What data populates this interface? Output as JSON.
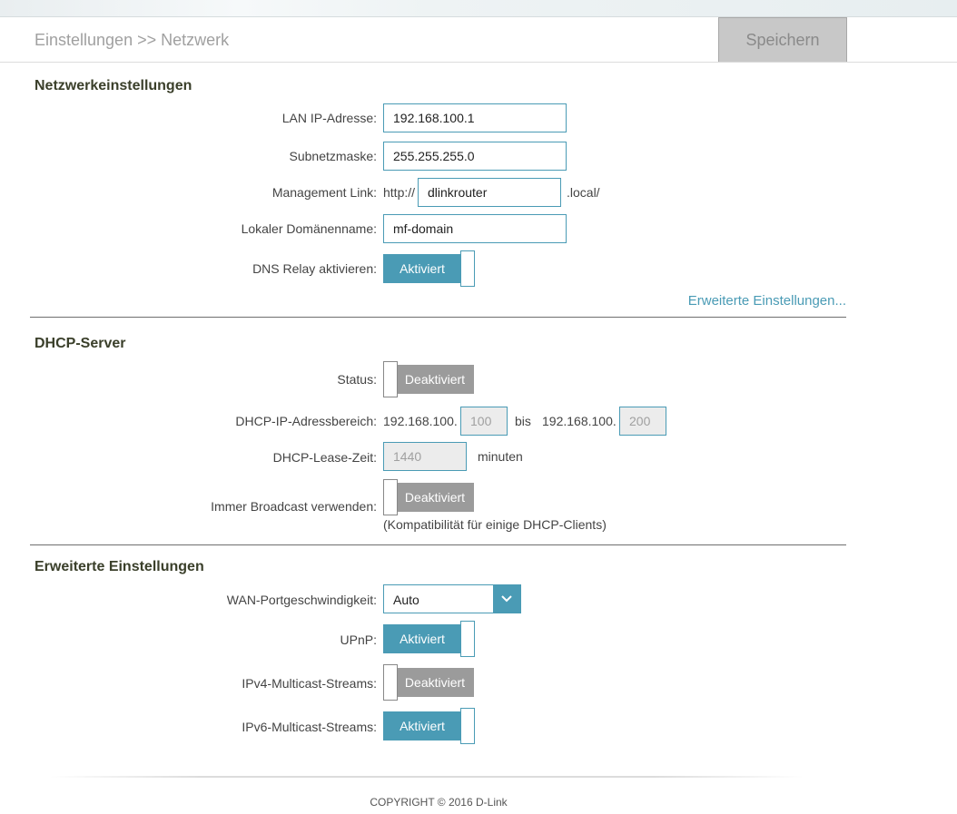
{
  "header": {
    "breadcrumb": "Einstellungen >> Netzwerk",
    "save_label": "Speichern"
  },
  "network": {
    "title": "Netzwerkeinstellungen",
    "lan_ip_label": "LAN IP-Adresse:",
    "lan_ip_value": "192.168.100.1",
    "subnet_label": "Subnetzmaske:",
    "subnet_value": "255.255.255.0",
    "mgmt_label": "Management Link:",
    "mgmt_prefix": "http://",
    "mgmt_value": "dlinkrouter",
    "mgmt_suffix": ".local/",
    "domain_label": "Lokaler Domänenname:",
    "domain_value": "mf-domain",
    "dns_label": "DNS Relay aktivieren:",
    "dns_state": "Aktiviert",
    "advanced_link": "Erweiterte Einstellungen..."
  },
  "dhcp": {
    "title": "DHCP-Server",
    "status_label": "Status:",
    "status_state": "Deaktiviert",
    "range_label": "DHCP-IP-Adressbereich:",
    "range_prefix_start": "192.168.100.",
    "range_start": "100",
    "range_bis": "bis",
    "range_prefix_end": "192.168.100.",
    "range_end": "200",
    "lease_label": "DHCP-Lease-Zeit:",
    "lease_value": "1440",
    "lease_unit": "minuten",
    "broadcast_label": "Immer Broadcast verwenden:",
    "broadcast_state": "Deaktiviert",
    "broadcast_note": "(Kompatibilität für einige DHCP-Clients)"
  },
  "advanced": {
    "title": "Erweiterte Einstellungen",
    "wan_label": "WAN-Portgeschwindigkeit:",
    "wan_value": "Auto",
    "upnp_label": "UPnP:",
    "upnp_state": "Aktiviert",
    "ipv4_label": "IPv4-Multicast-Streams:",
    "ipv4_state": "Deaktiviert",
    "ipv6_label": "IPv6-Multicast-Streams:",
    "ipv6_state": "Aktiviert"
  },
  "footer": {
    "copyright": "COPYRIGHT © 2016 D-Link"
  },
  "colors": {
    "accent": "#4a9bb5",
    "disabled_toggle": "#9b9b9b",
    "save_button": "#c8c8c8"
  }
}
